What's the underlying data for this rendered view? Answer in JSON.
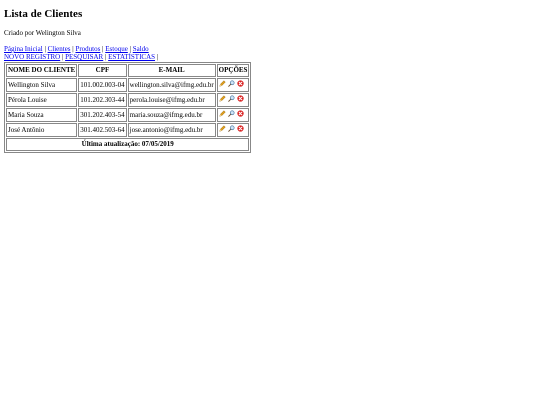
{
  "page": {
    "title": "Lista de Clientes",
    "subtitle": "Criado por Welington Silva"
  },
  "nav": {
    "primary": [
      "Página Inicial",
      "Clientes",
      "Produtos",
      "Estoque",
      "Saldo"
    ],
    "secondary": [
      "NOVO REGISTRO",
      "PESQUISAR",
      "ESTATÍSTICAS"
    ],
    "separator": "|"
  },
  "table": {
    "headers": [
      "NOME DO CLIENTE",
      "CPF",
      "E-MAIL",
      "OPÇÕES"
    ],
    "rows": [
      {
        "name": "Wellington Silva",
        "cpf": "101.002.003-04",
        "email": "wellington.silva@ifmg.edu.br"
      },
      {
        "name": "Pérola Louise",
        "cpf": "101.202.303-44",
        "email": "perola.louise@ifmg.edu.br"
      },
      {
        "name": "Maria Souza",
        "cpf": "301.202.403-54",
        "email": "maria.souza@ifmg.edu.br"
      },
      {
        "name": "José Antônio",
        "cpf": "301.402.503-64",
        "email": "jose.antonio@ifmg.edu.br"
      }
    ],
    "footer": "Última atualização: 07/05/2019"
  },
  "icons": {
    "edit": "pencil-icon",
    "view": "magnifier-icon",
    "delete": "delete-icon"
  },
  "colors": {
    "link": "#0000ee",
    "delete": "#d91f1f",
    "pencil": "#e0a020"
  }
}
